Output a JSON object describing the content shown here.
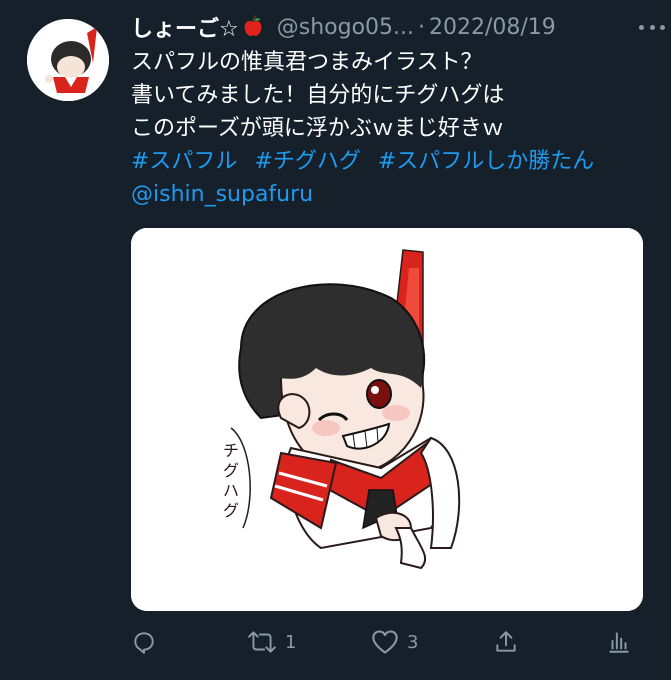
{
  "tweet": {
    "display_name": "しょーご☆",
    "handle": "@shogo05...",
    "separator": "·",
    "date": "2022/08/19",
    "text_lines": [
      "スパフルの惟真君つまみイラスト？",
      "書いてみました！自分的にチグハグは",
      "このポーズが頭に浮かぶｗまじ好きｗ"
    ],
    "hashtags": [
      "#スパフル",
      "#チグハグ",
      "#スパフルしか勝たん"
    ],
    "mention": "@ishin_supafuru",
    "media_caption": "チグハグ"
  },
  "actions": {
    "reply": {
      "icon": "reply-icon",
      "count": ""
    },
    "retweet": {
      "icon": "retweet-icon",
      "count": "1"
    },
    "like": {
      "icon": "heart-icon",
      "count": "3"
    },
    "share": {
      "icon": "share-icon",
      "count": ""
    },
    "analytics": {
      "icon": "analytics-icon",
      "count": ""
    }
  },
  "colors": {
    "background": "#15202b",
    "link": "#1d9bf0",
    "muted": "#8b98a5",
    "accent_red": "#d9231d"
  }
}
